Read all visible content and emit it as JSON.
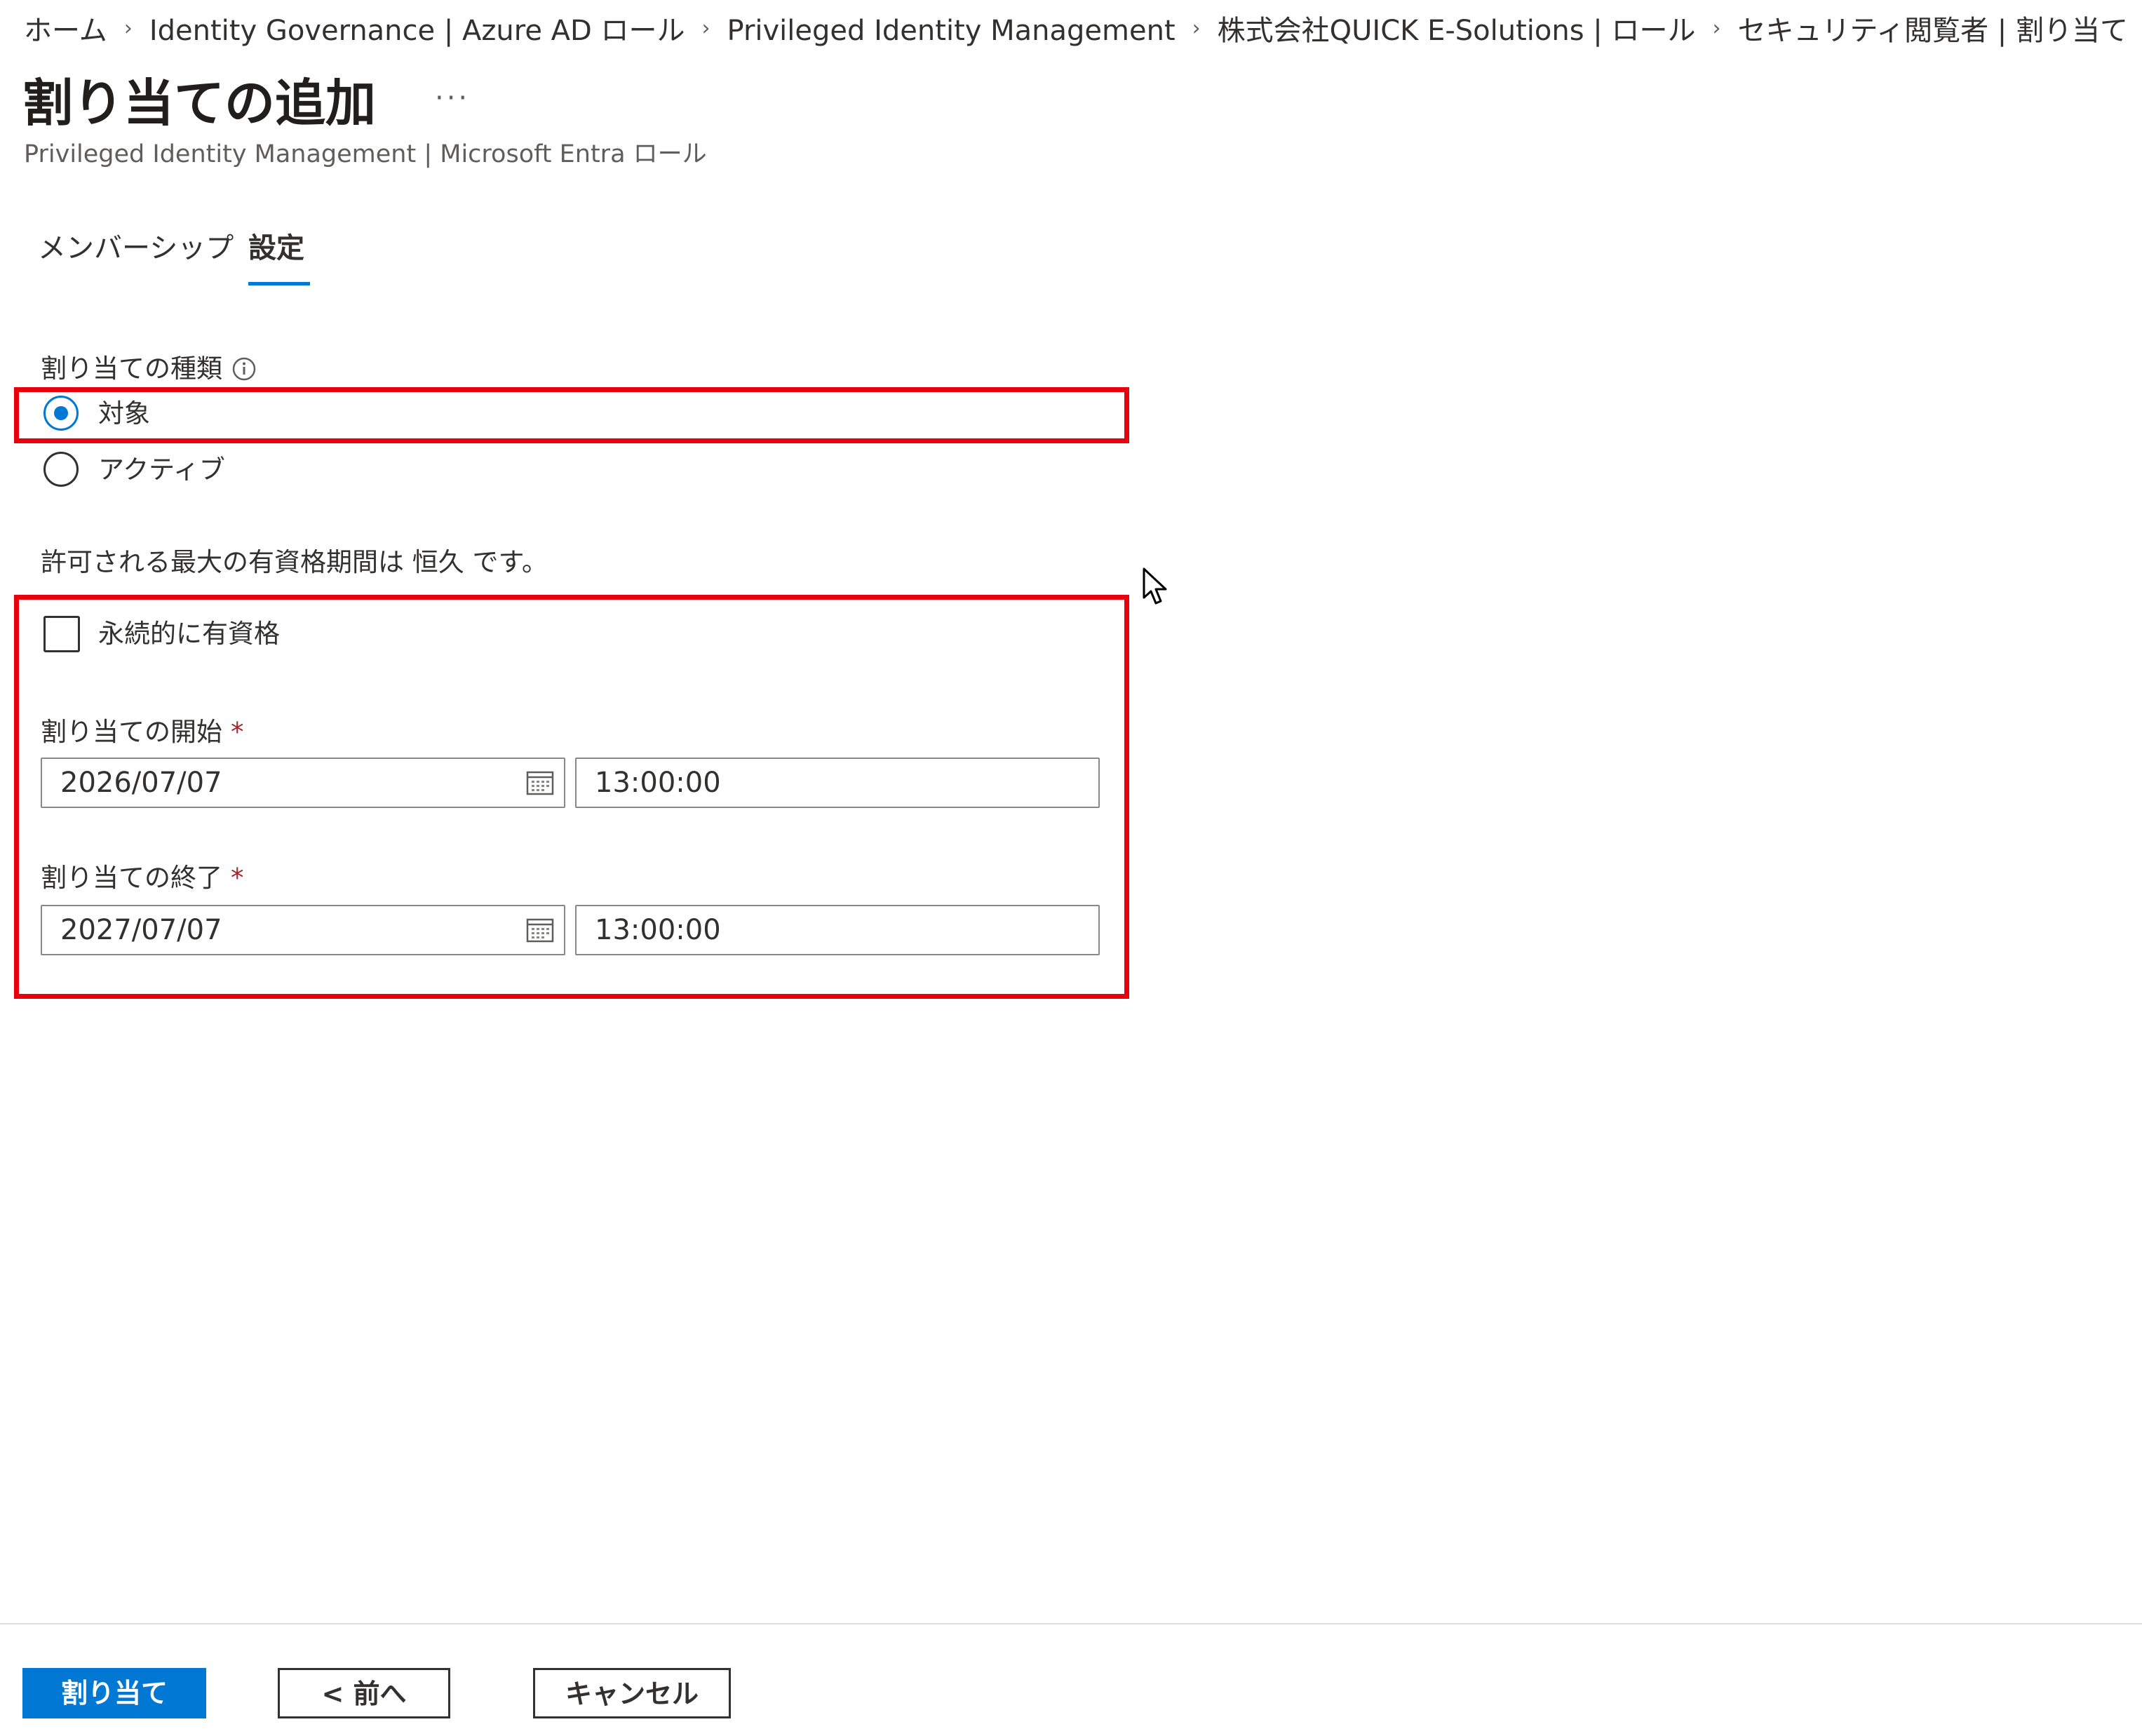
{
  "breadcrumb": {
    "items": [
      "ホーム",
      "Identity Governance | Azure AD ロール",
      "Privileged Identity Management",
      "株式会社QUICK E-Solutions | ロール",
      "セキュリティ閲覧者 | 割り当て"
    ],
    "separator": "›"
  },
  "page": {
    "title": "割り当ての追加",
    "more_label": "···",
    "subtitle": "Privileged Identity Management | Microsoft Entra ロール"
  },
  "tabs": {
    "membership": "メンバーシップ",
    "settings": "設定",
    "selected": "settings"
  },
  "assignment_type": {
    "label": "割り当ての種類",
    "info_icon": "info-icon",
    "options": [
      {
        "label": "対象",
        "checked": true
      },
      {
        "label": "アクティブ",
        "checked": false
      }
    ]
  },
  "max_duration_text": "許可される最大の有資格期間は 恒久 です。",
  "permanent_checkbox": {
    "label": "永続的に有資格",
    "checked": false
  },
  "start": {
    "label": "割り当ての開始",
    "required": "*",
    "date": "2026/07/07",
    "time": "13:00:00"
  },
  "end": {
    "label": "割り当ての終了",
    "required": "*",
    "date": "2027/07/07",
    "time": "13:00:00"
  },
  "footer": {
    "assign_label": "割り当て",
    "prev_label": "< 前へ",
    "cancel_label": "キャンセル"
  },
  "colors": {
    "accent": "#0078d4",
    "highlight": "#e8000d",
    "required": "#a4262c"
  }
}
